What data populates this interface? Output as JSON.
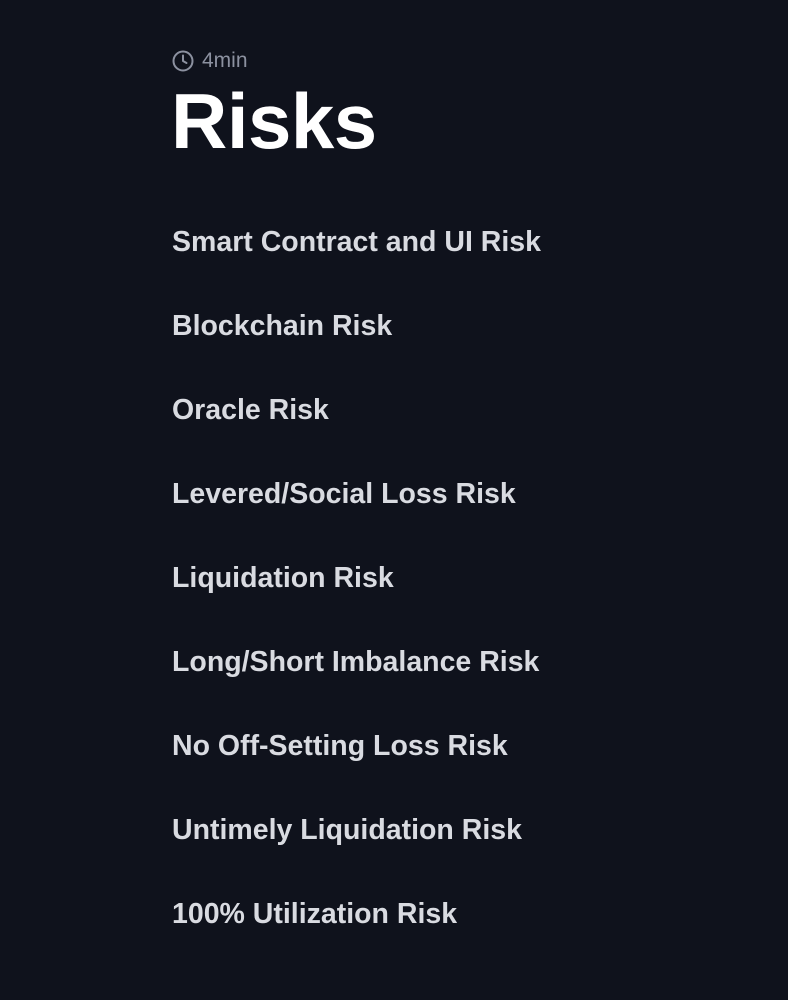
{
  "header": {
    "read_time": "4min",
    "title": "Risks"
  },
  "toc": {
    "items": [
      {
        "label": "Smart Contract and UI Risk"
      },
      {
        "label": "Blockchain Risk"
      },
      {
        "label": "Oracle Risk"
      },
      {
        "label": "Levered/Social Loss Risk"
      },
      {
        "label": "Liquidation Risk"
      },
      {
        "label": "Long/Short Imbalance Risk"
      },
      {
        "label": "No Off-Setting Loss Risk"
      },
      {
        "label": "Untimely Liquidation Risk"
      },
      {
        "label": "100% Utilization Risk"
      }
    ]
  },
  "colors": {
    "background": "#0f121c",
    "title": "#ffffff",
    "text": "#d9dbe1",
    "muted": "#8c91a0"
  },
  "icons": {
    "read_time": "clock-icon"
  }
}
